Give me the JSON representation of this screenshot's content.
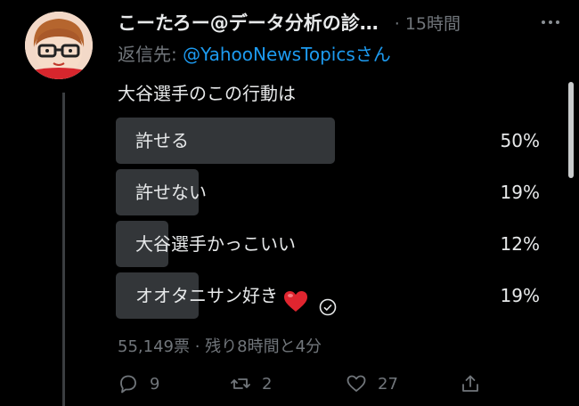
{
  "tweet": {
    "author_name": "こーたろー@データ分析の診…",
    "time": "· 15時間",
    "more_icon": "more-icon",
    "reply_prefix": "返信先: ",
    "reply_handle": "@YahooNewsTopics",
    "reply_suffix": "さん",
    "question": "大谷選手のこの行動は"
  },
  "poll": {
    "options": [
      {
        "label": "許せる",
        "percent_text": "50%",
        "percent": 50
      },
      {
        "label": "許せない",
        "percent_text": "19%",
        "percent": 19
      },
      {
        "label": "大谷選手かっこいい",
        "percent_text": "12%",
        "percent": 12
      },
      {
        "label": "オオタニサン好き",
        "percent_text": "19%",
        "percent": 19,
        "emoji": "heart-emoji",
        "voted": true
      }
    ],
    "stats": "55,149票 · 残り8時間と4分"
  },
  "actions": {
    "reply_count": "9",
    "retweet_count": "2",
    "like_count": "27"
  },
  "colors": {
    "background": "#000000",
    "text": "#e7e9ea",
    "muted": "#71767b",
    "link": "#1d9bf0",
    "bar": "#333639"
  }
}
